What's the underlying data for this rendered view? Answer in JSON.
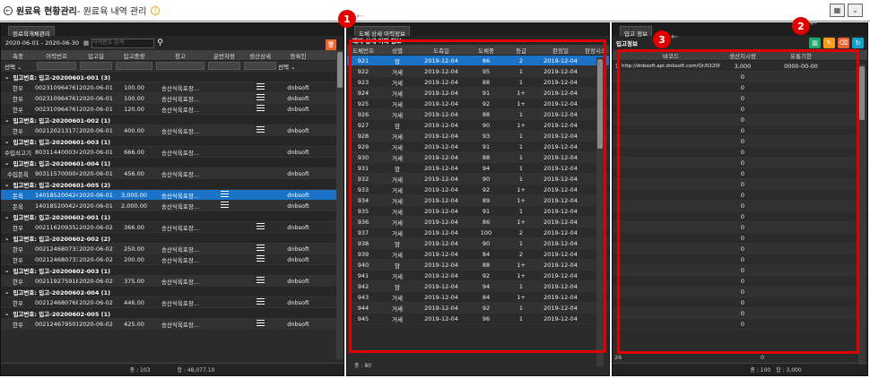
{
  "header": {
    "back_icon": "back-arrow-icon",
    "title": "원료육 현황관리",
    "subtitle": " - 원료육 내역 관리",
    "info_icon": "warning-icon"
  },
  "left": {
    "tab": "원료육개체관리",
    "date_range": "2020-06-01 - 2020-06-30",
    "search_placeholder": "이력번호 검색",
    "columns": [
      "축종",
      "이력번호",
      "입고일",
      "입고중량",
      "창고",
      "운반차량",
      "생산상세",
      "등록인"
    ],
    "filter_select": "선택",
    "filter_select2": "선택",
    "groups": [
      {
        "label": "입고번호: 입고-20200601-001 (3)",
        "rows": [
          [
            "한우",
            "002310964761",
            "2020-06-01",
            "100.00",
            "송산식육포장...",
            "",
            "≡",
            "dnbsoft"
          ],
          [
            "한우",
            "002310964761",
            "2020-06-01",
            "100.00",
            "송산식육포장...",
            "",
            "≡",
            "dnbsoft"
          ],
          [
            "한우",
            "002310964761",
            "2020-06-01",
            "120.00",
            "송산식육포장...",
            "",
            "≡",
            "dnbsoft"
          ]
        ]
      },
      {
        "label": "입고번호: 입고-20200601-002 (1)",
        "rows": [
          [
            "한우",
            "002120213173",
            "2020-06-01",
            "400.00",
            "송산식육포장...",
            "",
            "≡",
            "dnbsoft"
          ]
        ]
      },
      {
        "label": "입고번호: 입고-20200601-003 (1)",
        "rows": [
          [
            "수입쇠고기",
            "803114400034",
            "2020-06-01",
            "666.00",
            "송산식육포장...",
            "",
            "",
            "dnbsoft"
          ]
        ]
      },
      {
        "label": "입고번호: 입고-20200601-004 (1)",
        "rows": [
          [
            "수입돈육",
            "903115700004",
            "2020-06-01",
            "456.00",
            "송산식육포장...",
            "",
            "",
            "dnbsoft"
          ]
        ]
      },
      {
        "label": "입고번호: 입고-20200601-005 (2)",
        "rows": [
          [
            "돈육",
            "140185200424",
            "2020-06-01",
            "3,000.00",
            "송산식육포장...",
            "≡",
            "",
            "dnbsoft"
          ],
          [
            "돈육",
            "140185200424",
            "2020-06-01",
            "2,000.00",
            "송산식육포장...",
            "≡",
            "",
            "dnbsoft"
          ]
        ]
      },
      {
        "label": "입고번호: 입고-20200602-001 (1)",
        "rows": [
          [
            "한우",
            "002116209352",
            "2020-06-02",
            "366.00",
            "송산식육포장...",
            "",
            "≡",
            "dnbsoft"
          ]
        ]
      },
      {
        "label": "입고번호: 입고-20200602-002 (2)",
        "rows": [
          [
            "한우",
            "002124680733",
            "2020-06-02",
            "250.00",
            "송산식육포장...",
            "",
            "≡",
            "dnbsoft"
          ],
          [
            "한우",
            "002124680733",
            "2020-06-02",
            "200.00",
            "송산식육포장...",
            "",
            "≡",
            "dnbsoft"
          ]
        ]
      },
      {
        "label": "입고번호: 입고-20200602-003 (1)",
        "rows": [
          [
            "한우",
            "002119275918",
            "2020-06-02",
            "375.00",
            "송산식육포장...",
            "",
            "≡",
            "dnbsoft"
          ]
        ]
      },
      {
        "label": "입고번호: 입고-20200602-004 (1)",
        "rows": [
          [
            "한우",
            "002124680768",
            "2020-06-02",
            "446.00",
            "송산식육포장...",
            "",
            "≡",
            "dnbsoft"
          ]
        ]
      },
      {
        "label": "입고번호: 입고-20200602-005 (1)",
        "rows": [
          [
            "한우",
            "002124679501",
            "2020-06-02",
            "425.00",
            "송산식육포장...",
            "",
            "≡",
            "dnbsoft"
          ]
        ]
      }
    ],
    "footer_count": "총 : 103",
    "footer_sum": "합 : 48,077.10"
  },
  "middle": {
    "tab": "도체 상세 이력정보",
    "subtitle": "돼지 상세 이력 정보",
    "columns": [
      "도체번호",
      "성별",
      "도축일",
      "도체중",
      "등급",
      "판정일",
      "판정시스"
    ],
    "rows": [
      [
        "921",
        "암",
        "2019-12-04",
        "86",
        "2",
        "2019-12-04"
      ],
      [
        "922",
        "거세",
        "2019-12-04",
        "95",
        "1",
        "2019-12-04"
      ],
      [
        "923",
        "거세",
        "2019-12-04",
        "88",
        "1",
        "2019-12-04"
      ],
      [
        "924",
        "거세",
        "2019-12-04",
        "91",
        "1+",
        "2019-12-04"
      ],
      [
        "925",
        "거세",
        "2019-12-04",
        "92",
        "1+",
        "2019-12-04"
      ],
      [
        "926",
        "거세",
        "2019-12-04",
        "88",
        "1",
        "2019-12-04"
      ],
      [
        "927",
        "암",
        "2019-12-04",
        "90",
        "1+",
        "2019-12-04"
      ],
      [
        "928",
        "거세",
        "2019-12-04",
        "93",
        "1",
        "2019-12-04"
      ],
      [
        "929",
        "거세",
        "2019-12-04",
        "91",
        "1",
        "2019-12-04"
      ],
      [
        "930",
        "거세",
        "2019-12-04",
        "88",
        "1",
        "2019-12-04"
      ],
      [
        "931",
        "암",
        "2019-12-04",
        "94",
        "1",
        "2019-12-04"
      ],
      [
        "932",
        "거세",
        "2019-12-04",
        "90",
        "1",
        "2019-12-04"
      ],
      [
        "933",
        "거세",
        "2019-12-04",
        "92",
        "1+",
        "2019-12-04"
      ],
      [
        "934",
        "거세",
        "2019-12-04",
        "89",
        "1+",
        "2019-12-04"
      ],
      [
        "935",
        "거세",
        "2019-12-04",
        "91",
        "1",
        "2019-12-04"
      ],
      [
        "936",
        "거세",
        "2019-12-04",
        "86",
        "1+",
        "2019-12-04"
      ],
      [
        "937",
        "거세",
        "2019-12-04",
        "100",
        "2",
        "2019-12-04"
      ],
      [
        "938",
        "암",
        "2019-12-04",
        "90",
        "1",
        "2019-12-04"
      ],
      [
        "939",
        "거세",
        "2019-12-04",
        "84",
        "2",
        "2019-12-04"
      ],
      [
        "940",
        "암",
        "2019-12-04",
        "88",
        "1+",
        "2019-12-04"
      ],
      [
        "941",
        "거세",
        "2019-12-04",
        "92",
        "1+",
        "2019-12-04"
      ],
      [
        "942",
        "암",
        "2019-12-04",
        "94",
        "1",
        "2019-12-04"
      ],
      [
        "943",
        "거세",
        "2019-12-04",
        "84",
        "1+",
        "2019-12-04"
      ],
      [
        "944",
        "거세",
        "2019-12-04",
        "92",
        "1",
        "2019-12-04"
      ],
      [
        "945",
        "거세",
        "2019-12-04",
        "96",
        "1",
        "2019-12-04"
      ]
    ],
    "footer": "총 : 80"
  },
  "right": {
    "tab": "입고 정보",
    "subtitle": "입고정보",
    "columns": [
      "바코드",
      "생산지시량",
      "유통기한"
    ],
    "first_row": [
      "1",
      "http://dnbsoft.api.dnbsoft.com/Qr/0220006115...",
      "3,000",
      "0000-00-00"
    ],
    "row_count_label": "26",
    "zero": "0",
    "footer_count": "총 : 100",
    "footer_sum": "합 : 3,000",
    "toolbar": [
      {
        "name": "excel-icon",
        "color": "#1fa86a"
      },
      {
        "name": "edit-icon",
        "color": "#ff9b1a"
      },
      {
        "name": "eraser-icon",
        "color": "#f0642e"
      },
      {
        "name": "refresh-icon",
        "color": "#17a3c9"
      }
    ]
  },
  "annotations": {
    "badge1": "1",
    "badge2": "2",
    "badge3": "3",
    "arrow": "←"
  }
}
